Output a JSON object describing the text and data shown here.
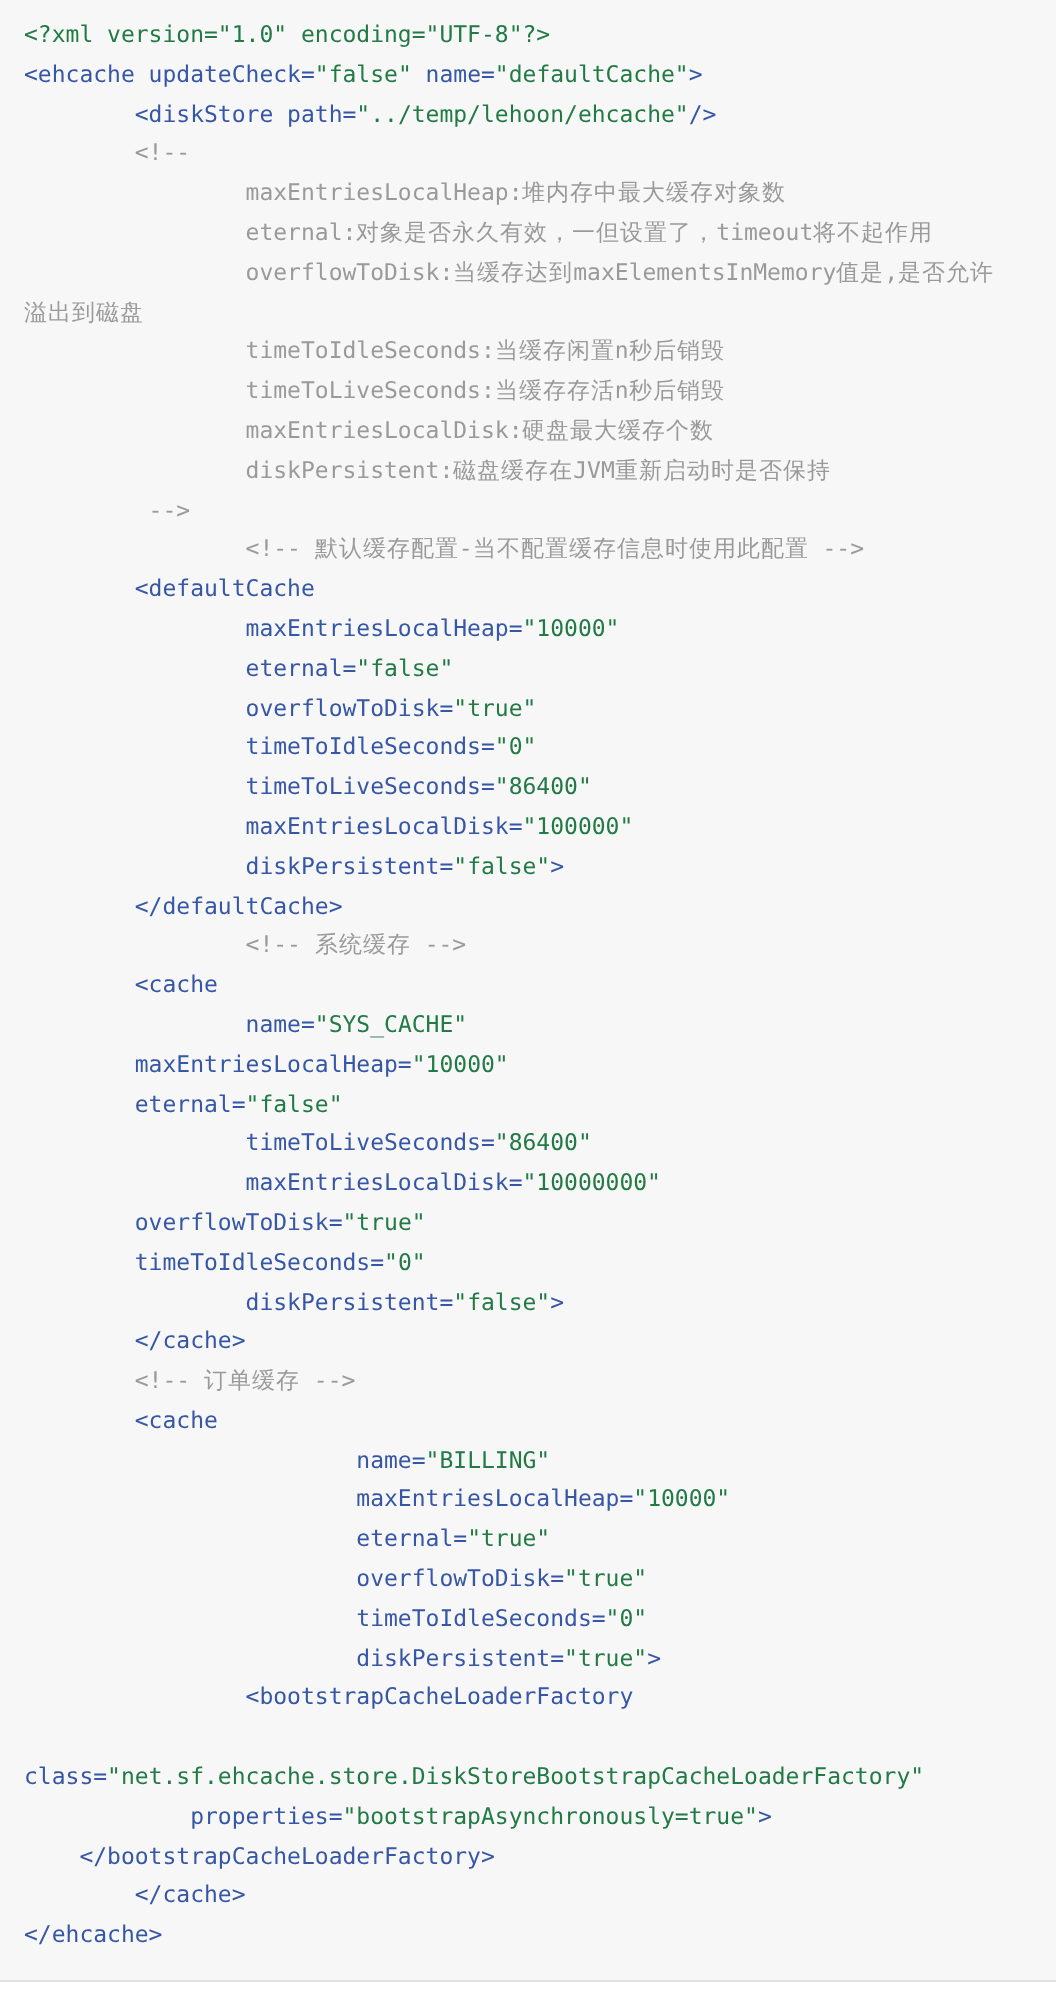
{
  "code_block": {
    "lines": [
      {
        "kind": "code",
        "parts": [
          {
            "kind": "decl",
            "text": "<?xml version=\"1.0\" encoding=\"UTF-8\"?>"
          }
        ]
      },
      {
        "kind": "code",
        "parts": [
          {
            "kind": "tag",
            "text": "<ehcache updateCheck="
          },
          {
            "kind": "str",
            "text": "\"false\""
          },
          {
            "kind": "tag",
            "text": " name="
          },
          {
            "kind": "str",
            "text": "\"defaultCache\""
          },
          {
            "kind": "tag",
            "text": ">"
          }
        ]
      },
      {
        "kind": "code",
        "parts": [
          {
            "kind": "tag",
            "text": "        <diskStore path="
          },
          {
            "kind": "str",
            "text": "\"../temp/lehoon/ehcache\""
          },
          {
            "kind": "tag",
            "text": "/>"
          }
        ]
      },
      {
        "kind": "code",
        "parts": [
          {
            "kind": "comment",
            "text": "        <!--"
          }
        ]
      },
      {
        "kind": "code",
        "parts": [
          {
            "kind": "comment",
            "text": "                maxEntriesLocalHeap:堆内存中最大缓存对象数"
          }
        ]
      },
      {
        "kind": "code",
        "parts": [
          {
            "kind": "comment",
            "text": "                eternal:对象是否永久有效，一但设置了，timeout将不起作用"
          }
        ]
      },
      {
        "kind": "code",
        "parts": [
          {
            "kind": "comment",
            "text": "                overflowToDisk:当缓存达到maxElementsInMemory值是,是否允许"
          }
        ]
      },
      {
        "kind": "code",
        "parts": [
          {
            "kind": "comment",
            "text": "溢出到磁盘"
          }
        ]
      },
      {
        "kind": "code",
        "parts": [
          {
            "kind": "comment",
            "text": "                timeToIdleSeconds:当缓存闲置n秒后销毁"
          }
        ]
      },
      {
        "kind": "code",
        "parts": [
          {
            "kind": "comment",
            "text": "                timeToLiveSeconds:当缓存存活n秒后销毁"
          }
        ]
      },
      {
        "kind": "code",
        "parts": [
          {
            "kind": "comment",
            "text": "                maxEntriesLocalDisk:硬盘最大缓存个数"
          }
        ]
      },
      {
        "kind": "code",
        "parts": [
          {
            "kind": "comment",
            "text": "                diskPersistent:磁盘缓存在JVM重新启动时是否保持"
          }
        ]
      },
      {
        "kind": "code",
        "parts": [
          {
            "kind": "comment",
            "text": "         -->"
          }
        ]
      },
      {
        "kind": "code",
        "parts": [
          {
            "kind": "comment",
            "text": "                <!-- 默认缓存配置-当不配置缓存信息时使用此配置 -->"
          }
        ]
      },
      {
        "kind": "code",
        "parts": [
          {
            "kind": "tag",
            "text": "        <defaultCache"
          }
        ]
      },
      {
        "kind": "code",
        "parts": [
          {
            "kind": "tag",
            "text": "                maxEntriesLocalHeap="
          },
          {
            "kind": "str",
            "text": "\"10000\""
          }
        ]
      },
      {
        "kind": "code",
        "parts": [
          {
            "kind": "tag",
            "text": "                eternal="
          },
          {
            "kind": "str",
            "text": "\"false\""
          }
        ]
      },
      {
        "kind": "code",
        "parts": [
          {
            "kind": "tag",
            "text": "                overflowToDisk="
          },
          {
            "kind": "str",
            "text": "\"true\""
          }
        ]
      },
      {
        "kind": "code",
        "parts": [
          {
            "kind": "tag",
            "text": "                timeToIdleSeconds="
          },
          {
            "kind": "str",
            "text": "\"0\""
          }
        ]
      },
      {
        "kind": "code",
        "parts": [
          {
            "kind": "tag",
            "text": "                timeToLiveSeconds="
          },
          {
            "kind": "str",
            "text": "\"86400\""
          }
        ]
      },
      {
        "kind": "code",
        "parts": [
          {
            "kind": "tag",
            "text": "                maxEntriesLocalDisk="
          },
          {
            "kind": "str",
            "text": "\"100000\""
          }
        ]
      },
      {
        "kind": "code",
        "parts": [
          {
            "kind": "tag",
            "text": "                diskPersistent="
          },
          {
            "kind": "str",
            "text": "\"false\""
          },
          {
            "kind": "tag",
            "text": ">"
          }
        ]
      },
      {
        "kind": "code",
        "parts": [
          {
            "kind": "tag",
            "text": "        </defaultCache>"
          }
        ]
      },
      {
        "kind": "code",
        "parts": [
          {
            "kind": "comment",
            "text": "                <!-- 系统缓存 -->"
          }
        ]
      },
      {
        "kind": "code",
        "parts": [
          {
            "kind": "tag",
            "text": "        <cache"
          }
        ]
      },
      {
        "kind": "code",
        "parts": [
          {
            "kind": "tag",
            "text": "                name="
          },
          {
            "kind": "str",
            "text": "\"SYS_CACHE\""
          }
        ]
      },
      {
        "kind": "code",
        "parts": [
          {
            "kind": "tag",
            "text": "        maxEntriesLocalHeap="
          },
          {
            "kind": "str",
            "text": "\"10000\""
          }
        ]
      },
      {
        "kind": "code",
        "parts": [
          {
            "kind": "tag",
            "text": "        eternal="
          },
          {
            "kind": "str",
            "text": "\"false\""
          }
        ]
      },
      {
        "kind": "code",
        "parts": [
          {
            "kind": "tag",
            "text": "                timeToLiveSeconds="
          },
          {
            "kind": "str",
            "text": "\"86400\""
          }
        ]
      },
      {
        "kind": "code",
        "parts": [
          {
            "kind": "tag",
            "text": "                maxEntriesLocalDisk="
          },
          {
            "kind": "str",
            "text": "\"10000000\""
          }
        ]
      },
      {
        "kind": "code",
        "parts": [
          {
            "kind": "tag",
            "text": "        overflowToDisk="
          },
          {
            "kind": "str",
            "text": "\"true\""
          }
        ]
      },
      {
        "kind": "code",
        "parts": [
          {
            "kind": "tag",
            "text": "        timeToIdleSeconds="
          },
          {
            "kind": "str",
            "text": "\"0\""
          }
        ]
      },
      {
        "kind": "code",
        "parts": [
          {
            "kind": "tag",
            "text": "                diskPersistent="
          },
          {
            "kind": "str",
            "text": "\"false\""
          },
          {
            "kind": "tag",
            "text": ">"
          }
        ]
      },
      {
        "kind": "code",
        "parts": [
          {
            "kind": "tag",
            "text": "        </cache>"
          }
        ]
      },
      {
        "kind": "code",
        "parts": [
          {
            "kind": "comment",
            "text": "        <!-- 订单缓存 -->"
          }
        ]
      },
      {
        "kind": "code",
        "parts": [
          {
            "kind": "tag",
            "text": "        <cache"
          }
        ]
      },
      {
        "kind": "code",
        "parts": [
          {
            "kind": "tag",
            "text": "                        name="
          },
          {
            "kind": "str",
            "text": "\"BILLING\""
          }
        ]
      },
      {
        "kind": "code",
        "parts": [
          {
            "kind": "tag",
            "text": "                        maxEntriesLocalHeap="
          },
          {
            "kind": "str",
            "text": "\"10000\""
          }
        ]
      },
      {
        "kind": "code",
        "parts": [
          {
            "kind": "tag",
            "text": "                        eternal="
          },
          {
            "kind": "str",
            "text": "\"true\""
          }
        ]
      },
      {
        "kind": "code",
        "parts": [
          {
            "kind": "tag",
            "text": "                        overflowToDisk="
          },
          {
            "kind": "str",
            "text": "\"true\""
          }
        ]
      },
      {
        "kind": "code",
        "parts": [
          {
            "kind": "tag",
            "text": "                        timeToIdleSeconds="
          },
          {
            "kind": "str",
            "text": "\"0\""
          }
        ]
      },
      {
        "kind": "code",
        "parts": [
          {
            "kind": "tag",
            "text": "                        diskPersistent="
          },
          {
            "kind": "str",
            "text": "\"true\""
          },
          {
            "kind": "tag",
            "text": ">"
          }
        ]
      },
      {
        "kind": "code",
        "parts": [
          {
            "kind": "tag",
            "text": "                <bootstrapCacheLoaderFactory"
          }
        ]
      },
      {
        "kind": "blank"
      },
      {
        "kind": "code",
        "parts": [
          {
            "kind": "tag",
            "text": "class="
          },
          {
            "kind": "str",
            "text": "\"net.sf.ehcache.store.DiskStoreBootstrapCacheLoaderFactory\""
          }
        ]
      },
      {
        "kind": "code",
        "parts": [
          {
            "kind": "tag",
            "text": "            properties="
          },
          {
            "kind": "str",
            "text": "\"bootstrapAsynchronously=true\""
          },
          {
            "kind": "tag",
            "text": ">"
          }
        ]
      },
      {
        "kind": "code",
        "parts": [
          {
            "kind": "tag",
            "text": "    </bootstrapCacheLoaderFactory>"
          }
        ]
      },
      {
        "kind": "code",
        "parts": [
          {
            "kind": "tag",
            "text": "        </cache>"
          }
        ]
      },
      {
        "kind": "code",
        "parts": [
          {
            "kind": "tag",
            "text": "</ehcache>"
          }
        ]
      }
    ]
  }
}
